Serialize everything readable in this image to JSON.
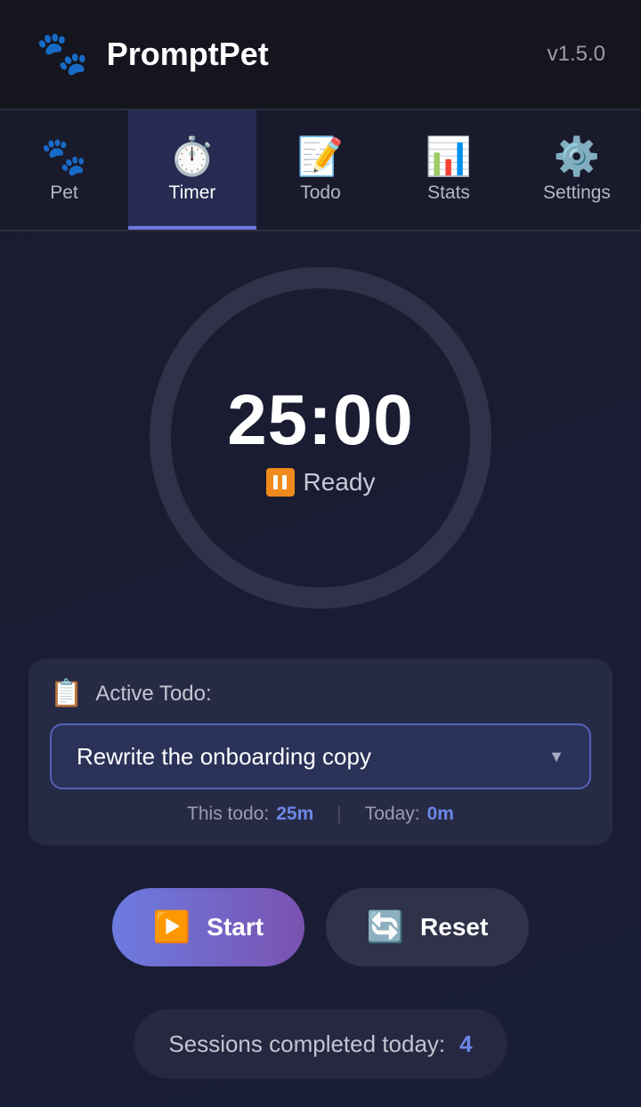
{
  "header": {
    "logo_icon": "🐾",
    "title": "PromptPet",
    "version": "v1.5.0"
  },
  "tabs": [
    {
      "icon": "🐾",
      "label": "Pet",
      "active": false
    },
    {
      "icon": "⏱️",
      "label": "Timer",
      "active": true
    },
    {
      "icon": "📝",
      "label": "Todo",
      "active": false
    },
    {
      "icon": "📊",
      "label": "Stats",
      "active": false
    },
    {
      "icon": "⚙️",
      "label": "Settings",
      "active": false
    }
  ],
  "timer": {
    "time": "25:00",
    "status": "Ready",
    "status_icon": "pause-icon"
  },
  "todo": {
    "icon": "📋",
    "heading": "Active Todo:",
    "selected": "Rewrite the onboarding copy",
    "this_todo_label": "This todo:",
    "this_todo_value": "25m",
    "today_label": "Today:",
    "today_value": "0m",
    "separator": "|"
  },
  "buttons": {
    "start_icon": "▶️",
    "start_label": "Start",
    "reset_icon": "🔄",
    "reset_label": "Reset"
  },
  "sessions": {
    "label": "Sessions completed today:",
    "count": "4"
  },
  "colors": {
    "accent": "#6c7be0",
    "start_gradient_end": "#7a52b0",
    "status_orange": "#f08a1c"
  }
}
